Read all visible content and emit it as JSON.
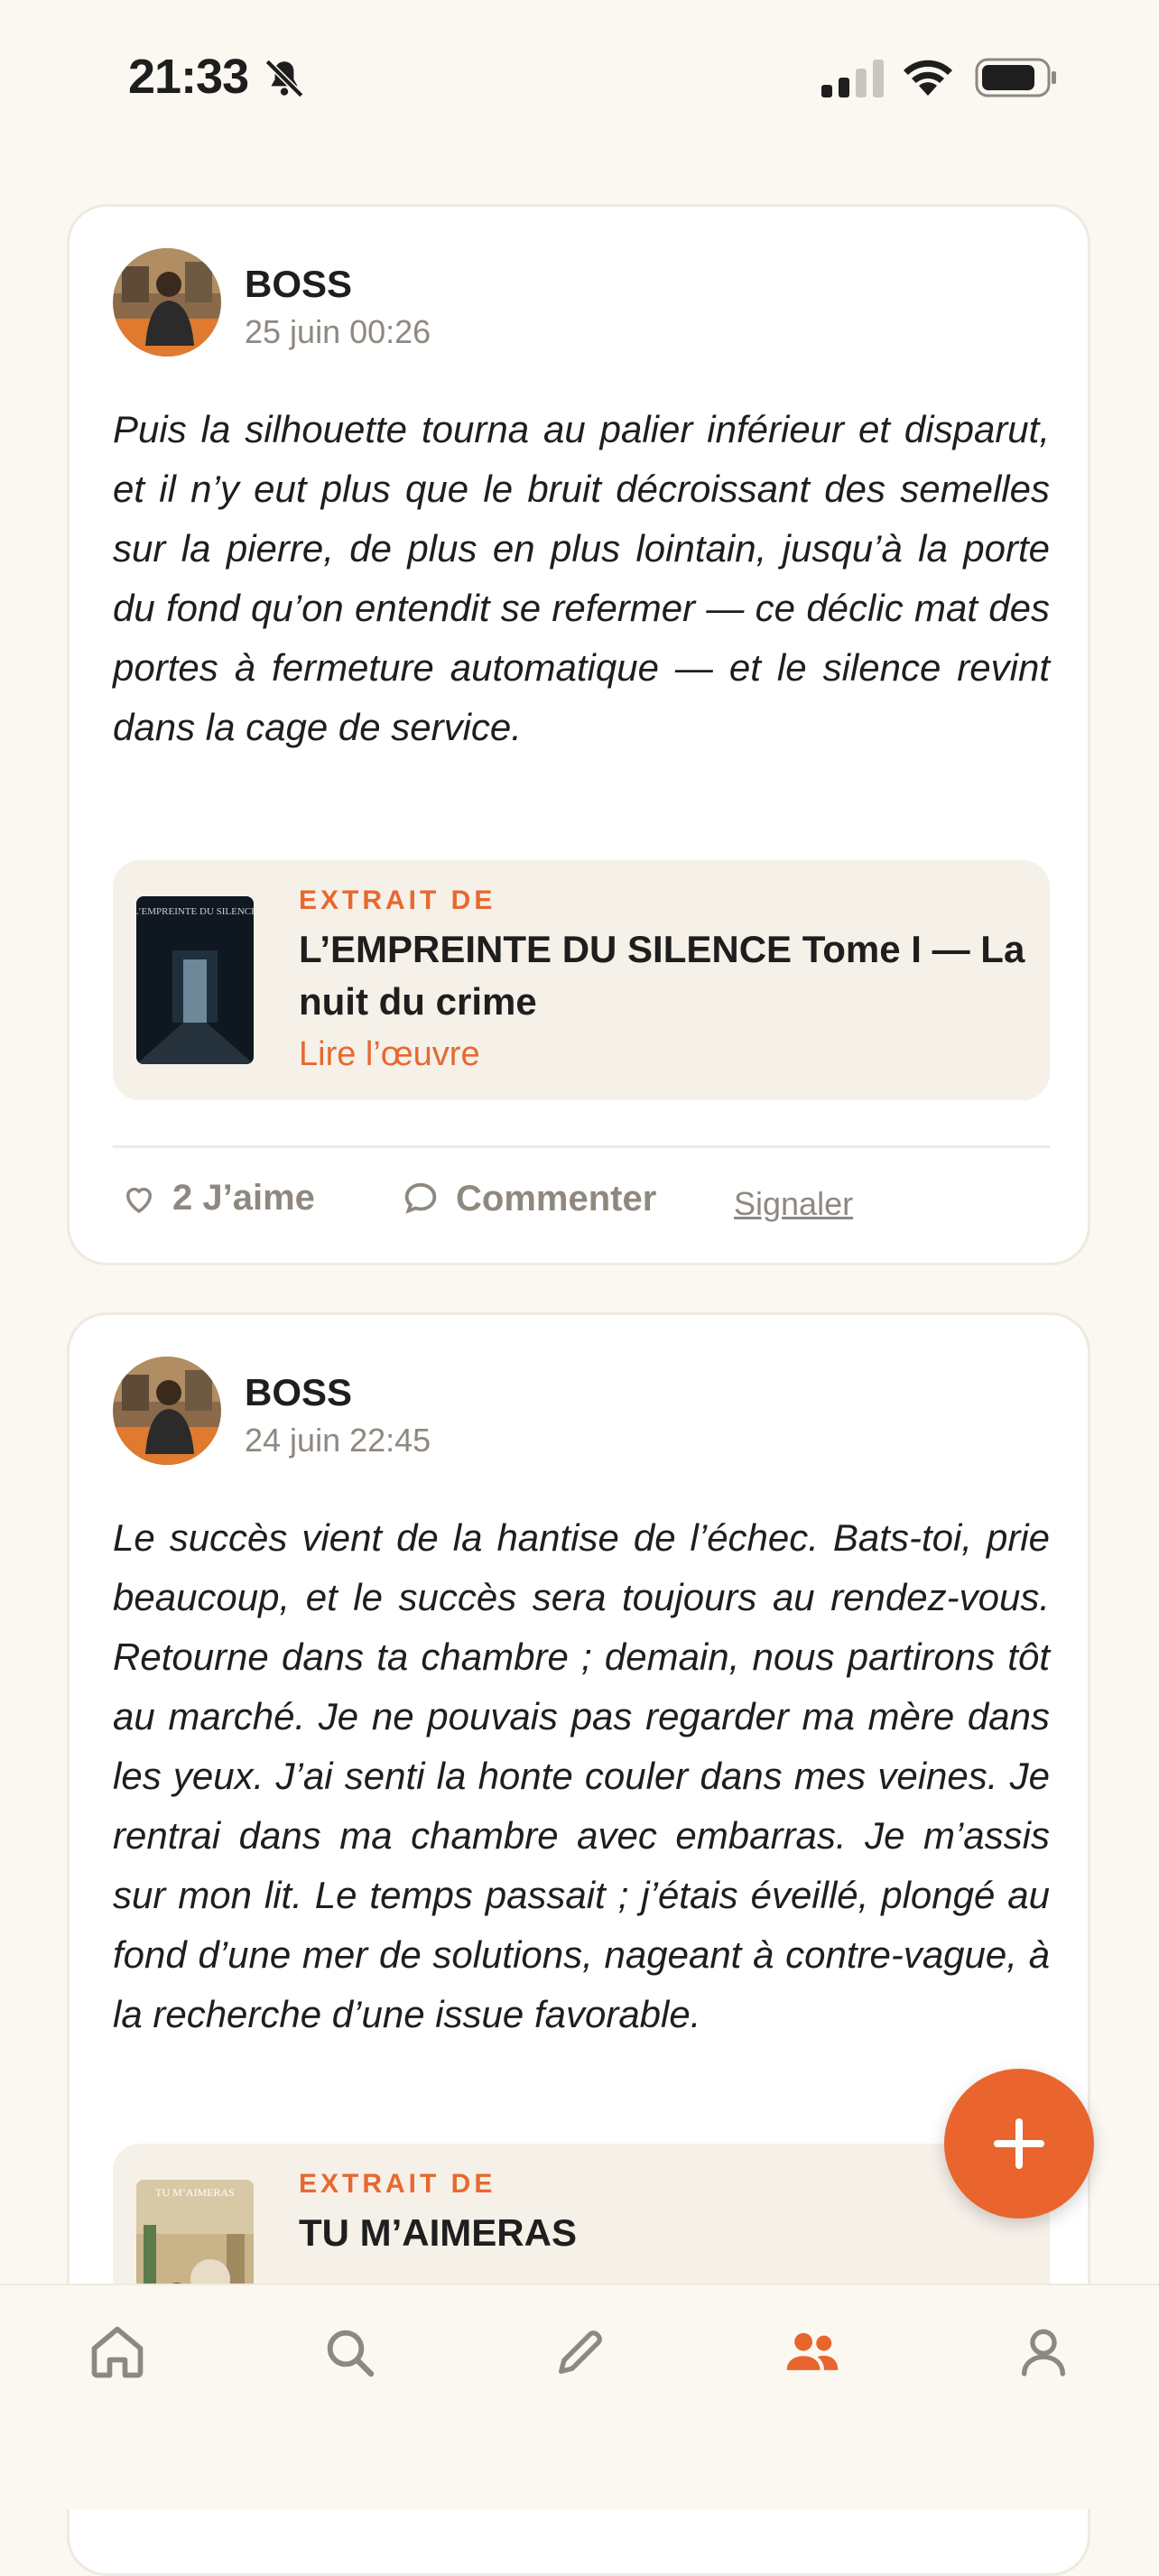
{
  "status_bar": {
    "time": "21:33"
  },
  "posts": [
    {
      "author": "BOSS",
      "date": "25 juin 00:26",
      "text": "Puis la silhouette tourna au palier inférieur et disparut, et il n’y eut plus que le bruit décroissant des semelles sur la pierre, de plus en plus lointain, jusqu’à la porte du fond qu’on entendit se refermer — ce déclic mat des portes à fermeture automatique — et le silence revint dans la cage de service.",
      "book": {
        "label": "EXTRAIT DE",
        "title": "L’EMPREINTE DU SILENCE Tome I — La nuit du crime",
        "link": "Lire l’œuvre",
        "cover_text": "L’EMPREINTE DU SILENCE"
      },
      "likes_label": "2 J’aime",
      "comment_label": "Commenter",
      "report_label": "Signaler"
    },
    {
      "author": "BOSS",
      "date": "24 juin 22:45",
      "text": "Le succès vient de la hantise de l’échec. Bats-toi, prie beaucoup, et le succès sera toujours au rendez-vous. Retourne dans ta chambre ; demain, nous partirons tôt au marché. Je ne pouvais pas regarder ma mère dans les yeux. J’ai senti la honte couler dans mes veines. Je rentrai dans ma chambre avec embarras. Je m’assis sur mon lit. Le temps passait ; j’étais éveillé, plongé au fond d’une mer de solutions, nageant à contre-vague, à la recherche d’une issue favorable.",
      "book": {
        "label": "EXTRAIT DE",
        "title": "TU M’AIMERAS",
        "cover_text": "TU M’AIMERAS"
      }
    }
  ],
  "tab_bar": {
    "active": "community",
    "icons": [
      "home-icon",
      "search-icon",
      "pencil-icon",
      "community-icon",
      "profile-icon"
    ]
  },
  "colors": {
    "accent": "#E9652D",
    "background": "#FBF8F2",
    "muted": "#8E8880"
  }
}
